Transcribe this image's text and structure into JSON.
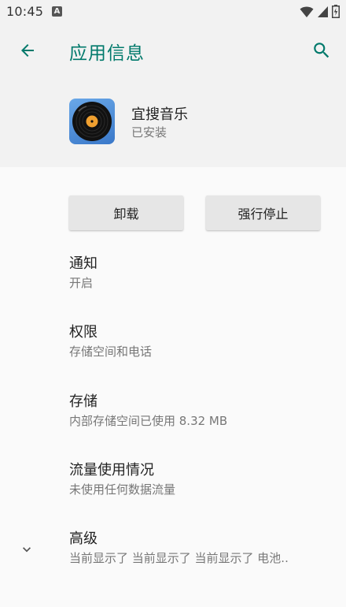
{
  "status_bar": {
    "time": "10:45",
    "notification_letter": "A"
  },
  "header": {
    "title": "应用信息",
    "back_icon": "arrow-left-icon",
    "search_icon": "search-icon",
    "accent_color": "#00796b"
  },
  "app": {
    "name": "宜搜音乐",
    "status": "已安装",
    "icon": "vinyl-record-icon"
  },
  "buttons": {
    "uninstall_label": "卸载",
    "force_stop_label": "强行停止"
  },
  "settings": [
    {
      "title": "通知",
      "subtitle": "开启"
    },
    {
      "title": "权限",
      "subtitle": "存储空间和电话"
    },
    {
      "title": "存储",
      "subtitle": "内部存储空间已使用 8.32 MB"
    },
    {
      "title": "流量使用情况",
      "subtitle": "未使用任何数据流量"
    },
    {
      "title": "高级",
      "subtitle": "当前显示了 当前显示了 当前显示了 电池.."
    }
  ]
}
